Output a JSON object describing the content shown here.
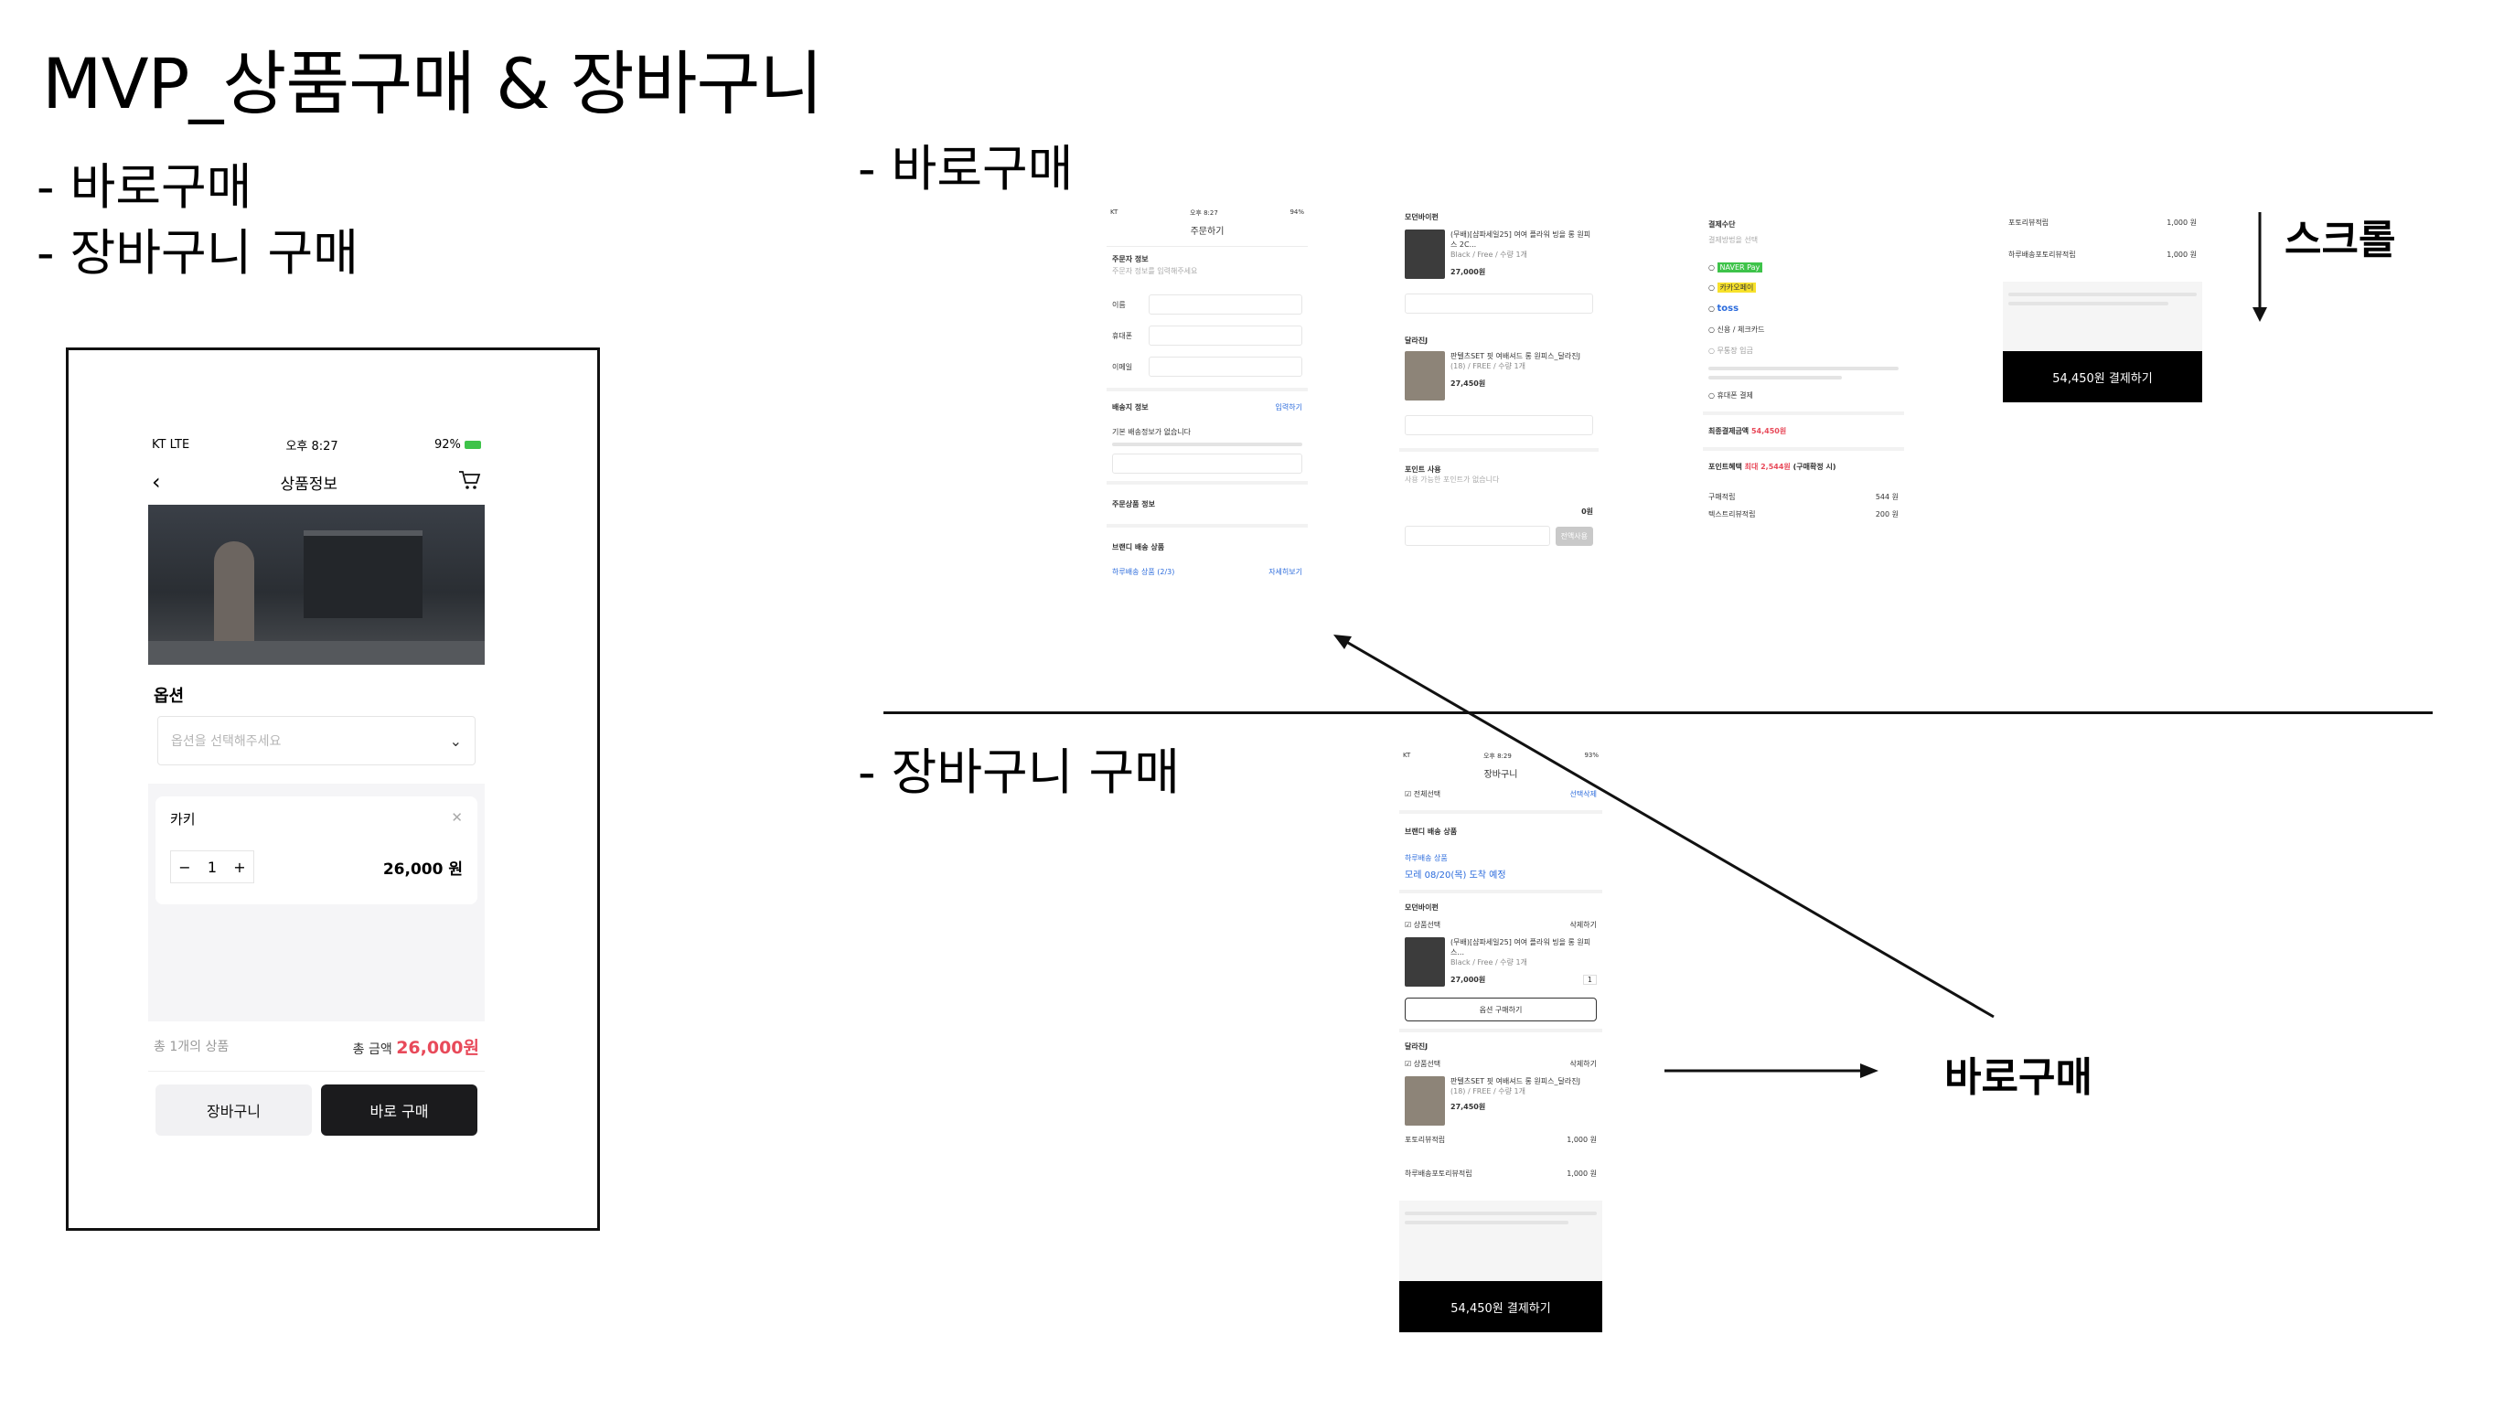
{
  "slide": {
    "title": "MVP_상품구매 & 장바구니",
    "bullets": [
      "-  바로구매",
      "-  장바구니 구매"
    ],
    "section_direct": "- 바로구매",
    "section_cart": "- 장바구니 구매",
    "scroll_label": "스크롤",
    "direct_buy_label": "바로구매"
  },
  "phone": {
    "status_carrier": "KT  LTE",
    "status_time": "오후 8:27",
    "status_battery": "92%",
    "nav_title": "상품정보",
    "option_label": "옵션",
    "option_placeholder": "옵션을 선택해주세요",
    "selected_option": "카키",
    "quantity": "1",
    "item_price": "26,000 원",
    "total_count": "총 1개의 상품",
    "total_label": "총 금액",
    "total_amount": "26,000원",
    "cart_button": "장바구니",
    "buy_button": "바로 구매"
  },
  "thumb_order": {
    "nav_title": "주문하기",
    "orderer_info": "주문자 정보",
    "orderer_sub": "주문자 정보를 입력해주세요",
    "name_label": "이름",
    "phone_label": "휴대폰",
    "email_label": "이메일",
    "shipping_info": "배송지 정보",
    "shipping_link": "입력하기",
    "shipping_note": "기본 배송정보가 없습니다",
    "order_items": "주문상품 정보",
    "brand_shipping": "브랜디 배송 상품",
    "brand_badge": "하루배송 상품 (2/3)",
    "brand_more": "자세히보기"
  },
  "thumb_items": {
    "shop1": "모던바이펀",
    "item1_name": "(무배)[샵파세일25] 여여 플라워 빙을 롱 원피스 2C...",
    "item1_meta": "Black / Free / 수량 1개",
    "item1_price": "27,000원",
    "shop2": "달라진J",
    "item2_name": "판텔츠SET 핏 여배셔드 롱 원피스_달라진J",
    "item2_meta": "(18) / FREE / 수량 1개",
    "item2_price": "27,450원",
    "point_label": "포인트 사용",
    "point_sub": "사용 가능한 포인트가 없습니다",
    "point_value": "0원",
    "point_btn": "전액사용"
  },
  "thumb_payment": {
    "method_label": "결제수단",
    "method_sub": "결제방법을 선택",
    "methods": [
      "NAVER Pay",
      "카카오페이",
      "toss",
      "신용 / 체크카드",
      "무통장 입금",
      "휴대폰 결제"
    ],
    "final_label": "최종결제금액",
    "final_amount": "54,450원",
    "point_benefit": "포인트혜택",
    "point_benefit_amt": "최대 2,544원",
    "point_benefit_note": "(구매확정 시)",
    "purchase_point": "구매적립",
    "purchase_point_amt": "544 원",
    "text_review_point": "텍스트리뷰적립",
    "text_review_amt": "200 원"
  },
  "thumb_bottom": {
    "photo_review": "포토리뷰적립",
    "photo_review_amt": "1,000 원",
    "daily_review": "하루배송포토리뷰적립",
    "daily_review_amt": "1,000 원",
    "pay_button": "54,450원 결제하기"
  },
  "thumb_cart": {
    "nav_title": "장바구니",
    "select_all": "전체선택",
    "delete_selected": "선택삭제",
    "brand_shipping": "브랜디 배송 상품",
    "brand_badge": "하루배송 상품",
    "arrival": "모레 08/20(목) 도착 예정",
    "shop1": "모던바이펀",
    "shop1_select": "상품선택",
    "shop1_delete": "삭제하기",
    "item1_name": "(무배)[샵파세일25] 여여 플라워 빙을 롱 원피스...",
    "item1_meta": "Black / Free / 수량 1개",
    "item1_price": "27,000원",
    "item1_qty": "1",
    "change_option": "옵션 구매하기",
    "shop2": "달라진J",
    "shop2_select": "상품선택",
    "shop2_delete": "삭제하기",
    "item2_name": "판텔츠SET 핏 여배셔드 롱 원피스_달라진J",
    "item2_meta": "(18) / FREE / 수량 1개",
    "item2_price": "27,450원",
    "photo_review": "포토리뷰적립",
    "photo_review_amt": "1,000 원",
    "daily_review": "하루배송포토리뷰적립",
    "daily_review_amt": "1,000 원",
    "pay_button": "54,450원 결제하기"
  },
  "colors": {
    "accent_red": "#e84a5a",
    "dark_button": "#1b1b1d",
    "link_blue": "#2b6bdc"
  }
}
